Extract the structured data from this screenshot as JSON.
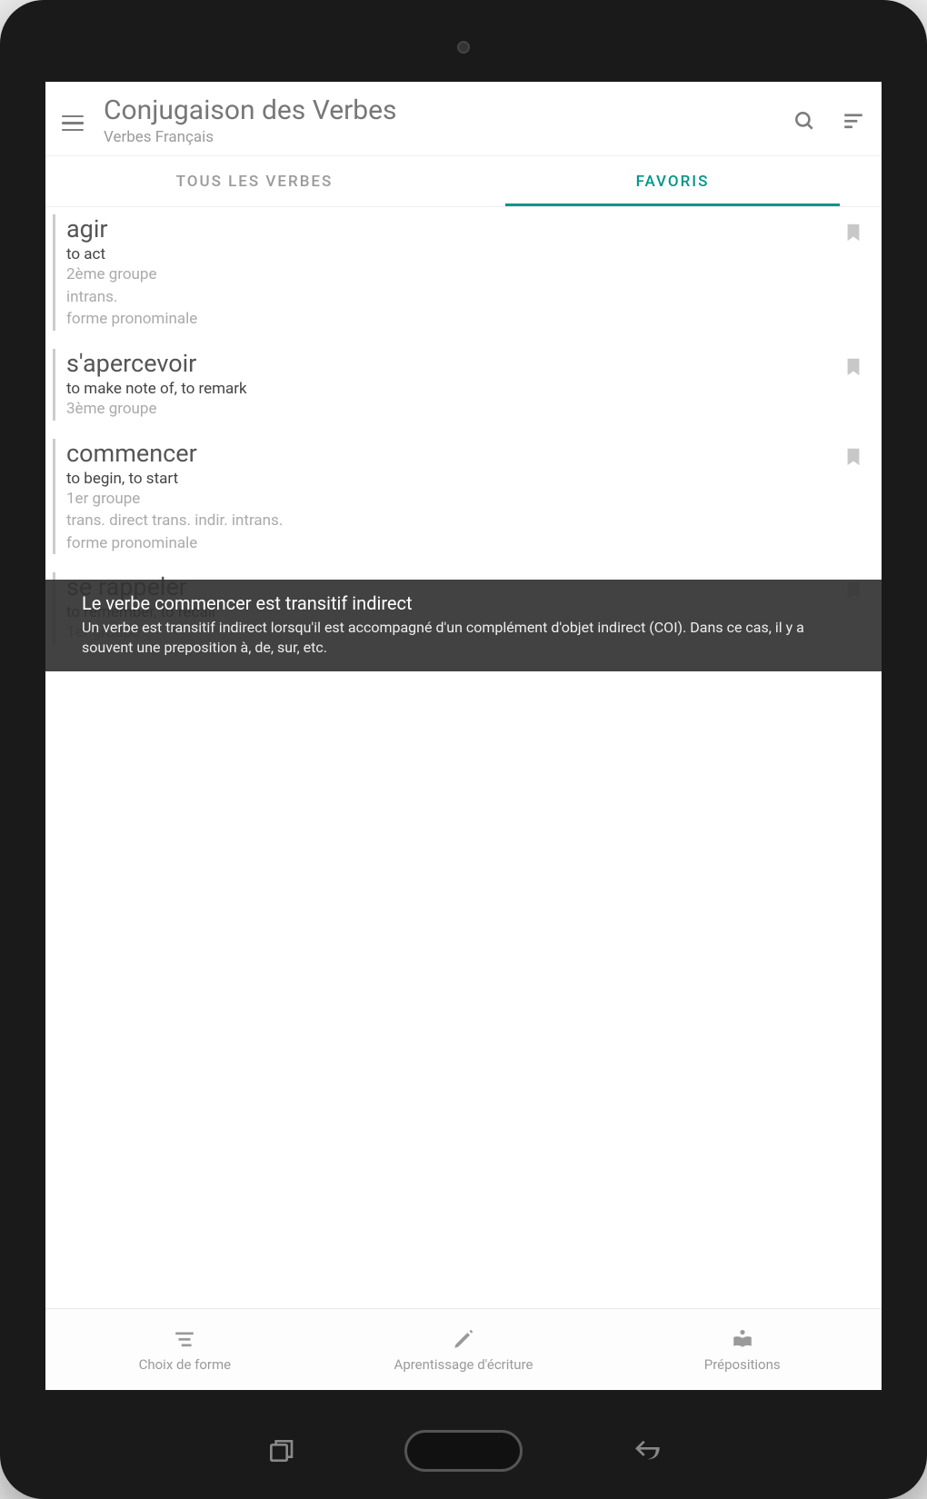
{
  "header": {
    "title": "Conjugaison des Verbes",
    "subtitle": "Verbes Français"
  },
  "tabs": [
    {
      "label": "TOUS LES VERBES",
      "active": false
    },
    {
      "label": "FAVORIS",
      "active": true
    }
  ],
  "verbs": [
    {
      "title": "agir",
      "translation": "to act",
      "group": "2ème groupe",
      "trans_type": "intrans.",
      "extra": "forme pronominale"
    },
    {
      "title": "s'apercevoir",
      "translation": "to make note of, to remark",
      "group": "3ème groupe",
      "trans_type": "",
      "extra": ""
    },
    {
      "title": "commencer",
      "translation": "to begin, to start",
      "group": "1er groupe",
      "trans_type": "trans. direct  trans. indir.  intrans.",
      "extra": "forme pronominale"
    },
    {
      "title": "se rappeler",
      "translation": "to remember, to recall",
      "group": "1er groupe",
      "trans_type": "",
      "extra": ""
    }
  ],
  "toast": {
    "title": "Le verbe commencer est transitif indirect",
    "body": "Un verbe est transitif indirect lorsqu'il est accompagné d'un complément d'objet indirect (COI). Dans ce cas, il y a souvent une preposition à, de, sur, etc."
  },
  "bottom_nav": [
    {
      "label": "Choix de forme",
      "icon": "filter-icon"
    },
    {
      "label": "Aprentissage d'écriture",
      "icon": "pencil-icon"
    },
    {
      "label": "Prépositions",
      "icon": "book-icon"
    }
  ]
}
